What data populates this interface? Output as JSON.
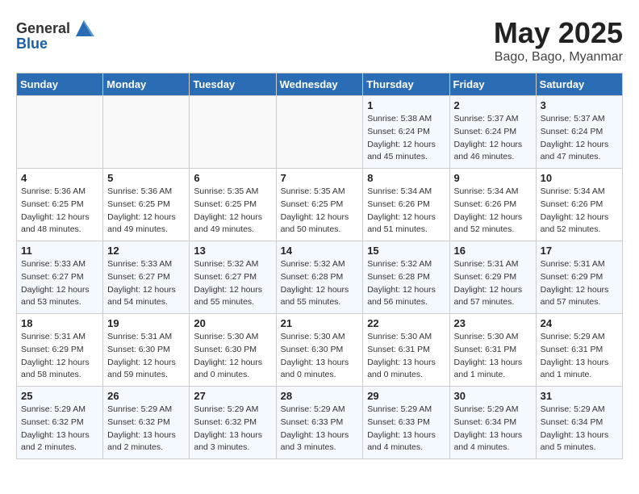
{
  "header": {
    "logo_general": "General",
    "logo_blue": "Blue",
    "month": "May 2025",
    "location": "Bago, Bago, Myanmar"
  },
  "days_of_week": [
    "Sunday",
    "Monday",
    "Tuesday",
    "Wednesday",
    "Thursday",
    "Friday",
    "Saturday"
  ],
  "weeks": [
    [
      {
        "day": "",
        "info": ""
      },
      {
        "day": "",
        "info": ""
      },
      {
        "day": "",
        "info": ""
      },
      {
        "day": "",
        "info": ""
      },
      {
        "day": "1",
        "info": "Sunrise: 5:38 AM\nSunset: 6:24 PM\nDaylight: 12 hours\nand 45 minutes."
      },
      {
        "day": "2",
        "info": "Sunrise: 5:37 AM\nSunset: 6:24 PM\nDaylight: 12 hours\nand 46 minutes."
      },
      {
        "day": "3",
        "info": "Sunrise: 5:37 AM\nSunset: 6:24 PM\nDaylight: 12 hours\nand 47 minutes."
      }
    ],
    [
      {
        "day": "4",
        "info": "Sunrise: 5:36 AM\nSunset: 6:25 PM\nDaylight: 12 hours\nand 48 minutes."
      },
      {
        "day": "5",
        "info": "Sunrise: 5:36 AM\nSunset: 6:25 PM\nDaylight: 12 hours\nand 49 minutes."
      },
      {
        "day": "6",
        "info": "Sunrise: 5:35 AM\nSunset: 6:25 PM\nDaylight: 12 hours\nand 49 minutes."
      },
      {
        "day": "7",
        "info": "Sunrise: 5:35 AM\nSunset: 6:25 PM\nDaylight: 12 hours\nand 50 minutes."
      },
      {
        "day": "8",
        "info": "Sunrise: 5:34 AM\nSunset: 6:26 PM\nDaylight: 12 hours\nand 51 minutes."
      },
      {
        "day": "9",
        "info": "Sunrise: 5:34 AM\nSunset: 6:26 PM\nDaylight: 12 hours\nand 52 minutes."
      },
      {
        "day": "10",
        "info": "Sunrise: 5:34 AM\nSunset: 6:26 PM\nDaylight: 12 hours\nand 52 minutes."
      }
    ],
    [
      {
        "day": "11",
        "info": "Sunrise: 5:33 AM\nSunset: 6:27 PM\nDaylight: 12 hours\nand 53 minutes."
      },
      {
        "day": "12",
        "info": "Sunrise: 5:33 AM\nSunset: 6:27 PM\nDaylight: 12 hours\nand 54 minutes."
      },
      {
        "day": "13",
        "info": "Sunrise: 5:32 AM\nSunset: 6:27 PM\nDaylight: 12 hours\nand 55 minutes."
      },
      {
        "day": "14",
        "info": "Sunrise: 5:32 AM\nSunset: 6:28 PM\nDaylight: 12 hours\nand 55 minutes."
      },
      {
        "day": "15",
        "info": "Sunrise: 5:32 AM\nSunset: 6:28 PM\nDaylight: 12 hours\nand 56 minutes."
      },
      {
        "day": "16",
        "info": "Sunrise: 5:31 AM\nSunset: 6:29 PM\nDaylight: 12 hours\nand 57 minutes."
      },
      {
        "day": "17",
        "info": "Sunrise: 5:31 AM\nSunset: 6:29 PM\nDaylight: 12 hours\nand 57 minutes."
      }
    ],
    [
      {
        "day": "18",
        "info": "Sunrise: 5:31 AM\nSunset: 6:29 PM\nDaylight: 12 hours\nand 58 minutes."
      },
      {
        "day": "19",
        "info": "Sunrise: 5:31 AM\nSunset: 6:30 PM\nDaylight: 12 hours\nand 59 minutes."
      },
      {
        "day": "20",
        "info": "Sunrise: 5:30 AM\nSunset: 6:30 PM\nDaylight: 12 hours\nand 0 minutes."
      },
      {
        "day": "21",
        "info": "Sunrise: 5:30 AM\nSunset: 6:30 PM\nDaylight: 13 hours\nand 0 minutes."
      },
      {
        "day": "22",
        "info": "Sunrise: 5:30 AM\nSunset: 6:31 PM\nDaylight: 13 hours\nand 0 minutes."
      },
      {
        "day": "23",
        "info": "Sunrise: 5:30 AM\nSunset: 6:31 PM\nDaylight: 13 hours\nand 1 minute."
      },
      {
        "day": "24",
        "info": "Sunrise: 5:29 AM\nSunset: 6:31 PM\nDaylight: 13 hours\nand 1 minute."
      }
    ],
    [
      {
        "day": "25",
        "info": "Sunrise: 5:29 AM\nSunset: 6:32 PM\nDaylight: 13 hours\nand 2 minutes."
      },
      {
        "day": "26",
        "info": "Sunrise: 5:29 AM\nSunset: 6:32 PM\nDaylight: 13 hours\nand 2 minutes."
      },
      {
        "day": "27",
        "info": "Sunrise: 5:29 AM\nSunset: 6:32 PM\nDaylight: 13 hours\nand 3 minutes."
      },
      {
        "day": "28",
        "info": "Sunrise: 5:29 AM\nSunset: 6:33 PM\nDaylight: 13 hours\nand 3 minutes."
      },
      {
        "day": "29",
        "info": "Sunrise: 5:29 AM\nSunset: 6:33 PM\nDaylight: 13 hours\nand 4 minutes."
      },
      {
        "day": "30",
        "info": "Sunrise: 5:29 AM\nSunset: 6:34 PM\nDaylight: 13 hours\nand 4 minutes."
      },
      {
        "day": "31",
        "info": "Sunrise: 5:29 AM\nSunset: 6:34 PM\nDaylight: 13 hours\nand 5 minutes."
      }
    ]
  ]
}
